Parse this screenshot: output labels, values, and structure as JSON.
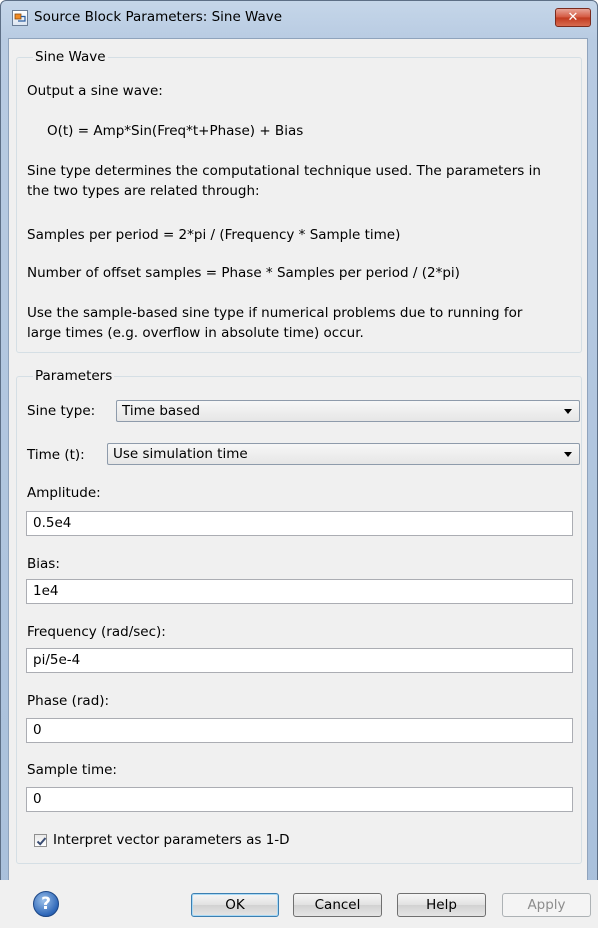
{
  "window": {
    "title": "Source Block Parameters: Sine Wave",
    "close_glyph": "✕"
  },
  "description": {
    "group_title": "Sine Wave",
    "lines": [
      "Output a sine wave:",
      "O(t) = Amp*Sin(Freq*t+Phase) + Bias",
      "Sine type determines the computational technique used. The parameters in",
      "the two types are related through:",
      "Samples per period = 2*pi / (Frequency * Sample time)",
      "Number of offset samples = Phase * Samples per period / (2*pi)",
      "Use the sample-based sine type if numerical problems due to running for",
      "large times (e.g. overflow in absolute time) occur."
    ]
  },
  "parameters": {
    "group_title": "Parameters",
    "sine_type": {
      "label": "Sine type:",
      "value": "Time based"
    },
    "time": {
      "label": "Time (t):",
      "value": "Use simulation time"
    },
    "amplitude": {
      "label": "Amplitude:",
      "value": "0.5e4"
    },
    "bias": {
      "label": "Bias:",
      "value": "1e4"
    },
    "frequency": {
      "label": "Frequency (rad/sec):",
      "value": "pi/5e-4"
    },
    "phase": {
      "label": "Phase (rad):",
      "value": "0"
    },
    "sample_time": {
      "label": "Sample time:",
      "value": "0"
    },
    "interpret_vector": {
      "label": "Interpret vector parameters as 1-D",
      "checked": true
    }
  },
  "buttons": {
    "help_glyph": "?",
    "ok": "OK",
    "cancel": "Cancel",
    "help": "Help",
    "apply": "Apply"
  },
  "icons": {
    "app": "simulink-block-icon",
    "close": "close-icon",
    "help": "help-icon",
    "dropdown": "chevron-down-icon",
    "check": "checkmark-icon"
  },
  "colors": {
    "close_button": "#c9462b",
    "help_icon": "#2d66b8",
    "default_button_border": "#3c7fb1"
  }
}
